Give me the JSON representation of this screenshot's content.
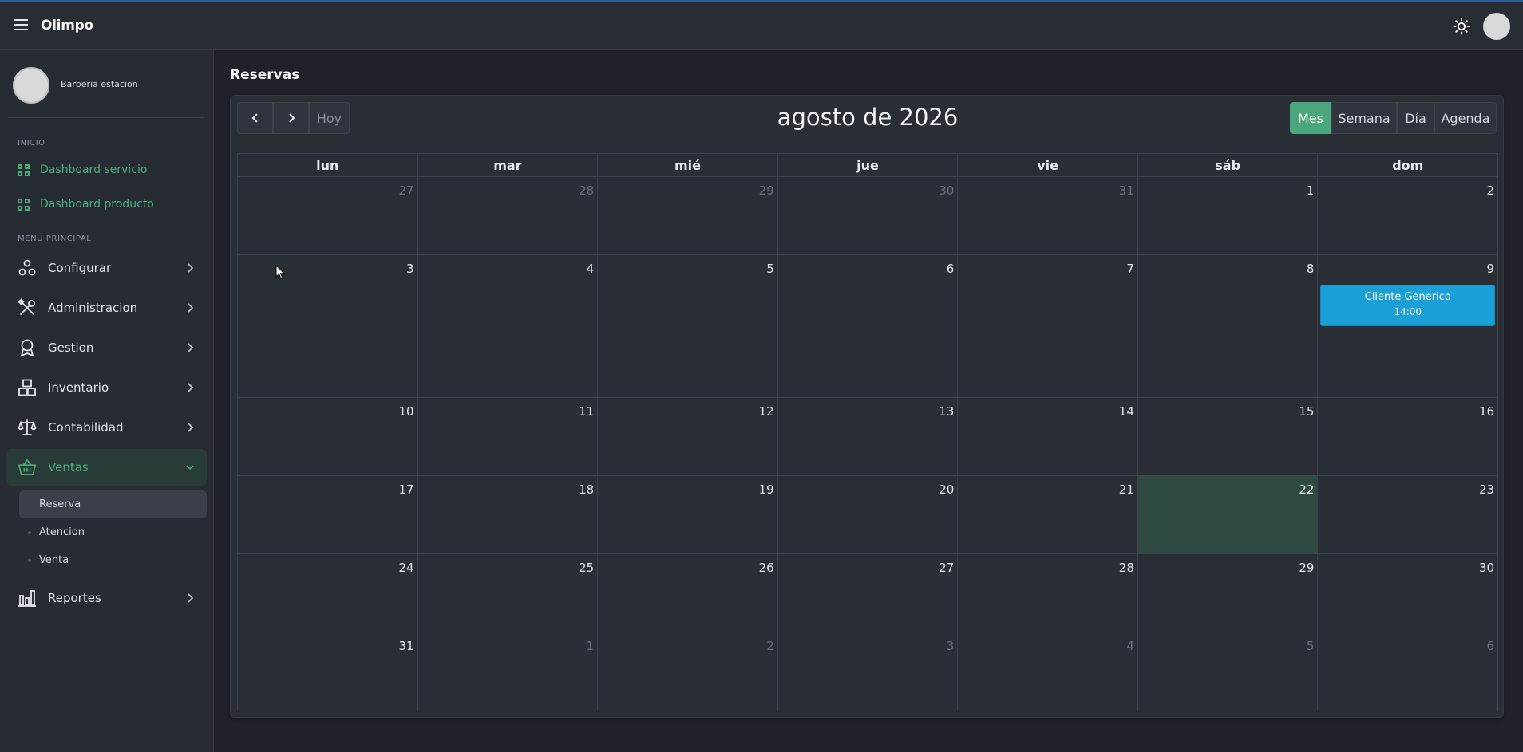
{
  "app": {
    "title": "Olimpo"
  },
  "header": {
    "theme_icon": "sun-icon",
    "avatar_icon": "user-avatar"
  },
  "sidebar": {
    "user_name": "Barberia estacion",
    "section_inicio": "INICIO",
    "dashboards": [
      {
        "label": "Dashboard servicio",
        "icon": "dashboard-icon"
      },
      {
        "label": "Dashboard producto",
        "icon": "dashboard-icon"
      }
    ],
    "section_menu": "MENÚ PRINCIPAL",
    "items": [
      {
        "label": "Configurar",
        "icon": "gears-icon",
        "expanded": false
      },
      {
        "label": "Administracion",
        "icon": "tools-icon",
        "expanded": false
      },
      {
        "label": "Gestion",
        "icon": "award-icon",
        "expanded": false
      },
      {
        "label": "Inventario",
        "icon": "boxes-icon",
        "expanded": false
      },
      {
        "label": "Contabilidad",
        "icon": "scale-icon",
        "expanded": false
      },
      {
        "label": "Ventas",
        "icon": "basket-icon",
        "expanded": true,
        "active": true
      },
      {
        "label": "Reportes",
        "icon": "bar-chart-icon",
        "expanded": false
      }
    ],
    "ventas_sub": [
      {
        "label": "Reserva",
        "active": true
      },
      {
        "label": "Atencion",
        "active": false
      },
      {
        "label": "Venta",
        "active": false
      }
    ],
    "accent_color": "#4caf7d"
  },
  "page": {
    "title": "Reservas"
  },
  "calendar": {
    "title": "agosto de 2026",
    "today_label": "Hoy",
    "views": [
      {
        "label": "Mes",
        "selected": true
      },
      {
        "label": "Semana",
        "selected": false
      },
      {
        "label": "Día",
        "selected": false
      },
      {
        "label": "Agenda",
        "selected": false
      }
    ],
    "weekdays": [
      "lun",
      "mar",
      "mié",
      "jue",
      "vie",
      "sáb",
      "dom"
    ],
    "weeks": [
      [
        {
          "d": "27",
          "other": true
        },
        {
          "d": "28",
          "other": true
        },
        {
          "d": "29",
          "other": true
        },
        {
          "d": "30",
          "other": true
        },
        {
          "d": "31",
          "other": true
        },
        {
          "d": "1"
        },
        {
          "d": "2"
        }
      ],
      [
        {
          "d": "3"
        },
        {
          "d": "4"
        },
        {
          "d": "5"
        },
        {
          "d": "6"
        },
        {
          "d": "7"
        },
        {
          "d": "8"
        },
        {
          "d": "9",
          "event": {
            "title": "Cliente Generico",
            "time": "14:00"
          }
        }
      ],
      [
        {
          "d": "10"
        },
        {
          "d": "11"
        },
        {
          "d": "12"
        },
        {
          "d": "13"
        },
        {
          "d": "14"
        },
        {
          "d": "15"
        },
        {
          "d": "16"
        }
      ],
      [
        {
          "d": "17"
        },
        {
          "d": "18"
        },
        {
          "d": "19"
        },
        {
          "d": "20"
        },
        {
          "d": "21"
        },
        {
          "d": "22",
          "today": true
        },
        {
          "d": "23"
        }
      ],
      [
        {
          "d": "24"
        },
        {
          "d": "25"
        },
        {
          "d": "26"
        },
        {
          "d": "27"
        },
        {
          "d": "28"
        },
        {
          "d": "29"
        },
        {
          "d": "30"
        }
      ],
      [
        {
          "d": "31"
        },
        {
          "d": "1",
          "other": true
        },
        {
          "d": "2",
          "other": true
        },
        {
          "d": "3",
          "other": true
        },
        {
          "d": "4",
          "other": true
        },
        {
          "d": "5",
          "other": true
        },
        {
          "d": "6",
          "other": true
        }
      ]
    ],
    "event_color": "#1a9fd6",
    "selected_view_color": "#4aa67c"
  }
}
